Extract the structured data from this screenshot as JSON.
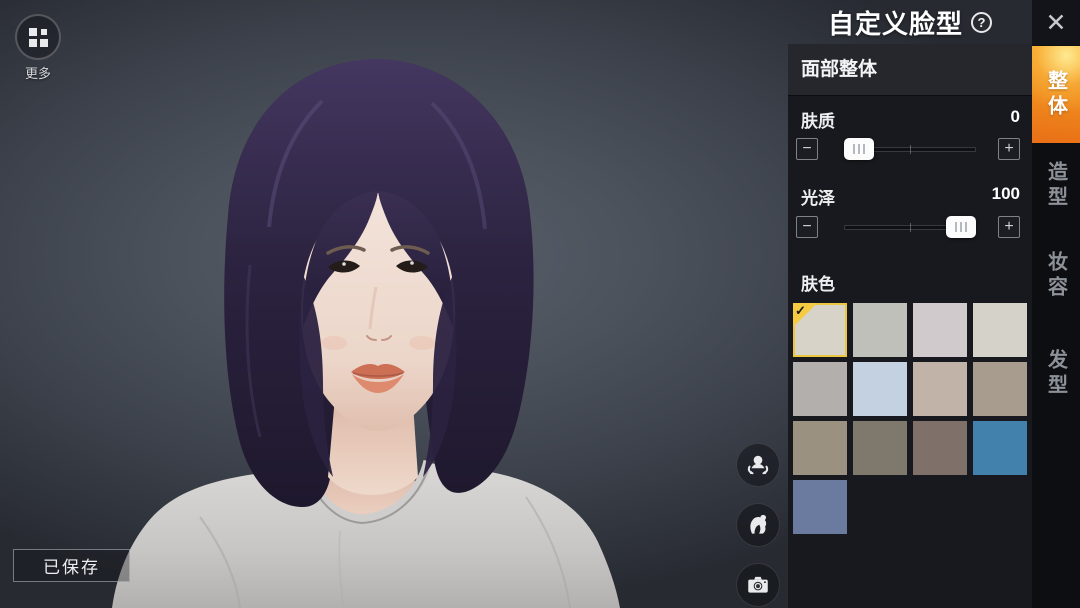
{
  "titlebar": {
    "title": "自定义脸型",
    "help_icon": "question-mark-icon",
    "close_icon": "✕"
  },
  "top_left": {
    "more_label": "更多",
    "more_icon": "grid-apps-icon"
  },
  "panel": {
    "header": "面部整体",
    "slider_minus": "−",
    "slider_plus": "+",
    "sliders": [
      {
        "label": "肤质",
        "value": "0",
        "position": 0
      },
      {
        "label": "光泽",
        "value": "100",
        "position": 100
      }
    ],
    "skin_color": {
      "label": "肤色",
      "selected_index": 0,
      "check_mark": "✓",
      "swatches": [
        "#d8d3c9",
        "#bfc0ba",
        "#d1cacd",
        "#d5d3c9",
        "#b3afac",
        "#c4d1e1",
        "#c1b3a8",
        "#a89c8f",
        "#9b9181",
        "#7f786c",
        "#7f706a",
        "#4281ab",
        "#6b7a9f"
      ]
    }
  },
  "tabs": [
    {
      "label": "整体",
      "active": true
    },
    {
      "label": "造型",
      "active": false
    },
    {
      "label": "妆容",
      "active": false
    },
    {
      "label": "发型",
      "active": false
    }
  ],
  "side_buttons": [
    {
      "icon": "rotate-character-icon"
    },
    {
      "icon": "hairstyle-icon"
    },
    {
      "icon": "camera-icon"
    }
  ],
  "saved_button": {
    "label": "已保存"
  },
  "colors": {
    "accent_orange": "#ef8a1e",
    "selected_yellow": "#ecc63e",
    "panel_bg": "#17191e",
    "scene_mid": "#4c525c"
  }
}
